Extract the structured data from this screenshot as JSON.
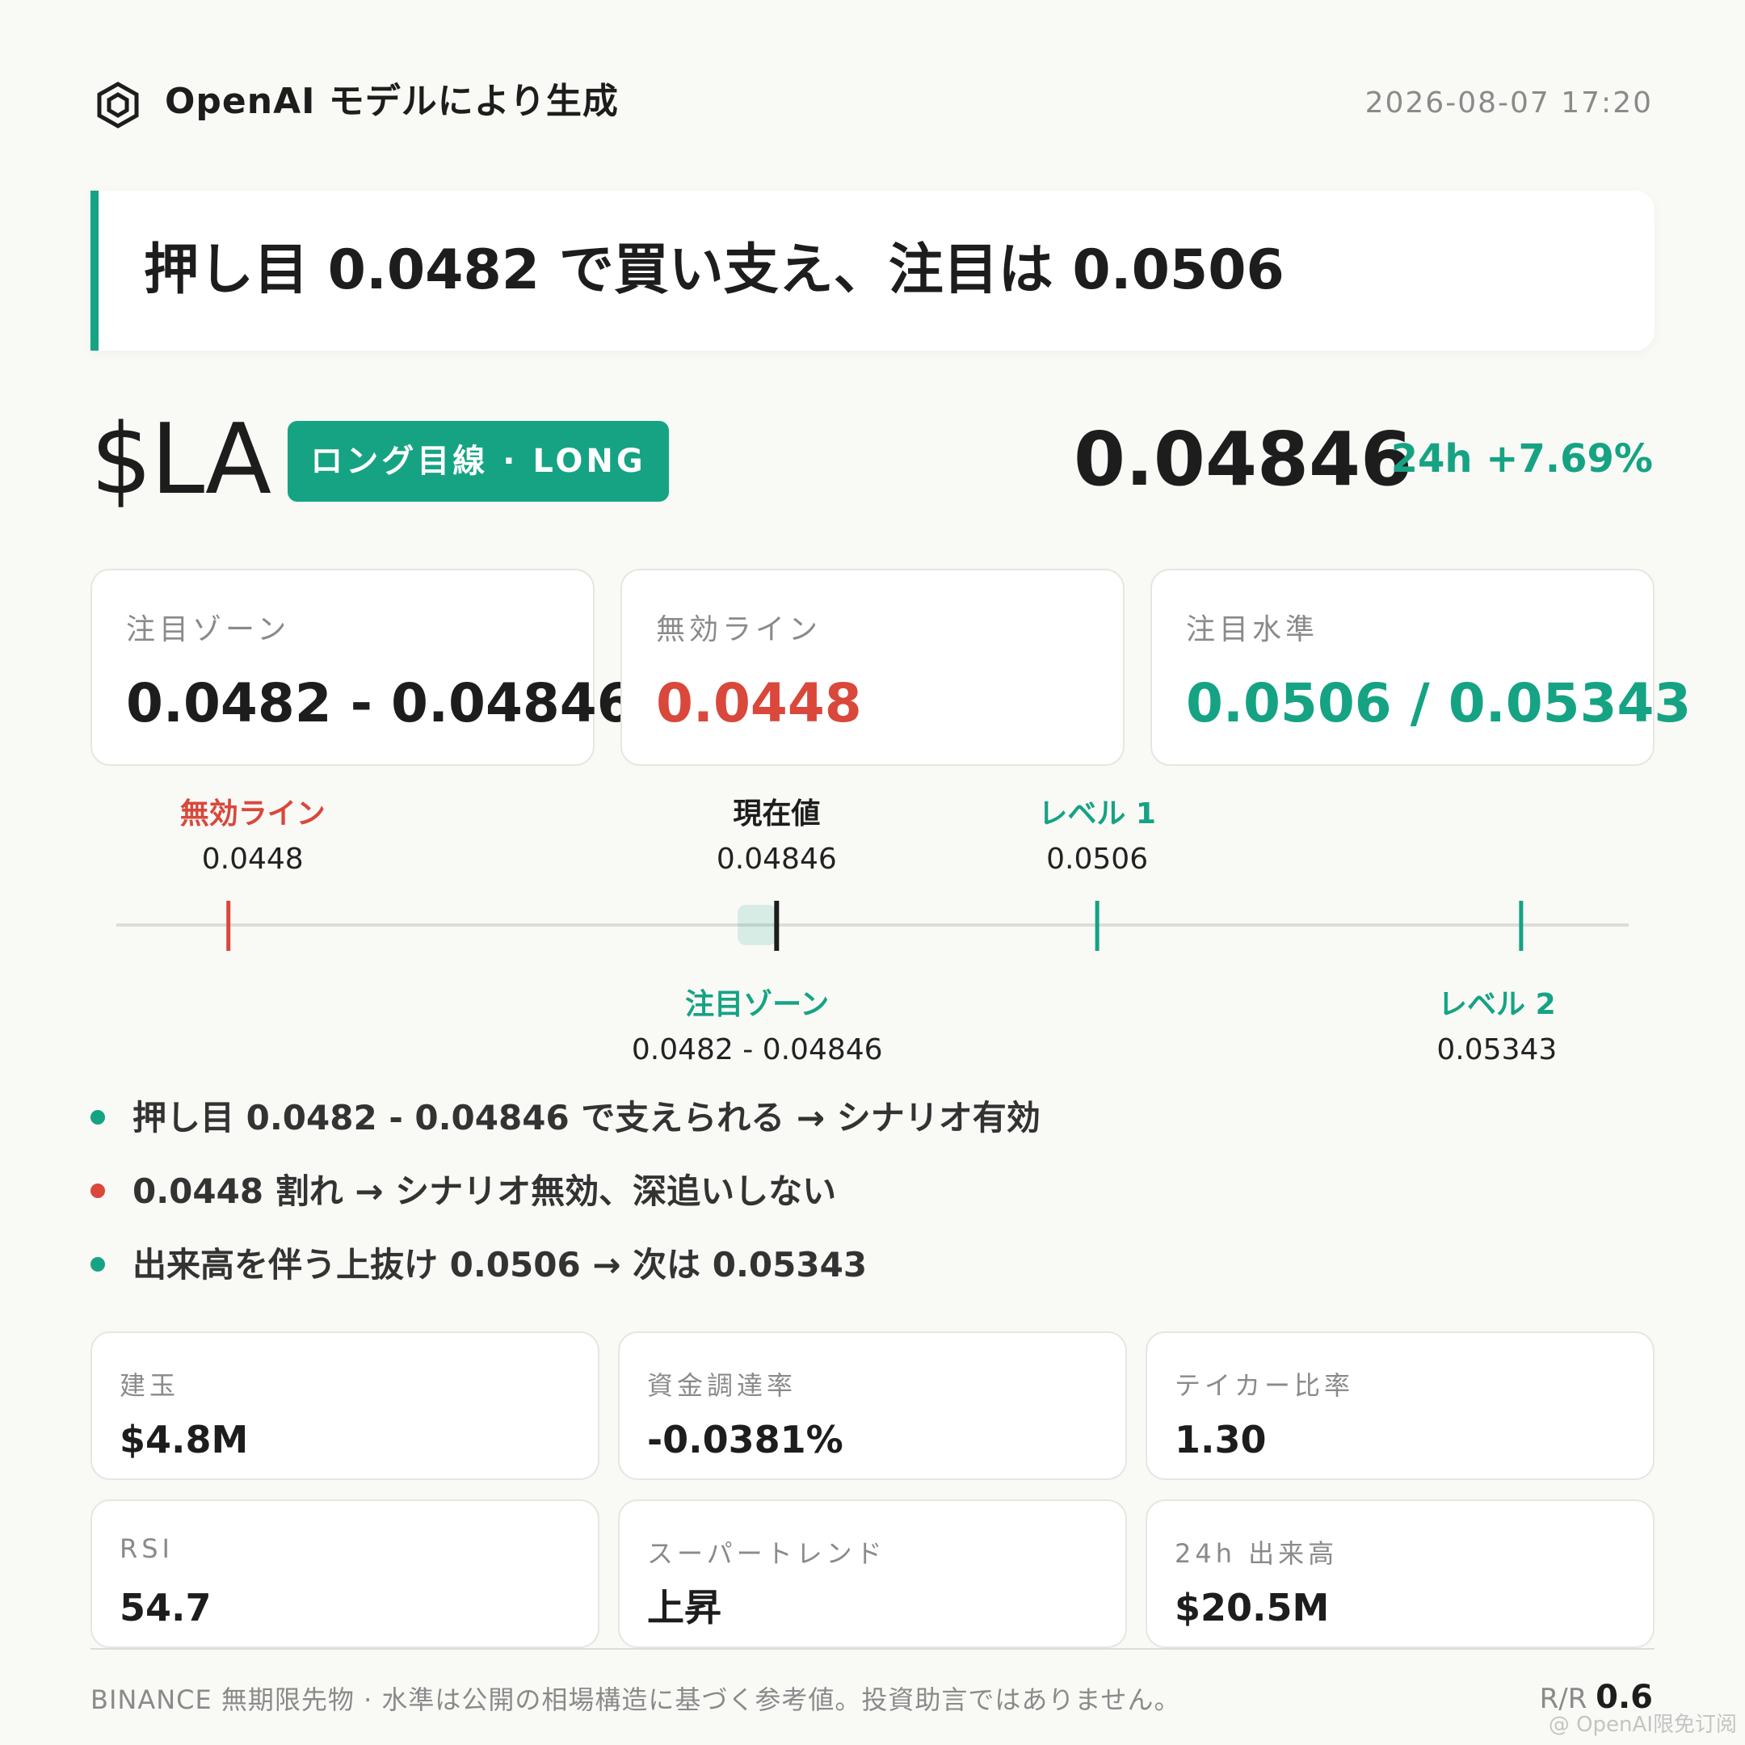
{
  "header": {
    "brand": "OpenAI モデルにより生成",
    "timestamp": "2026-08-07 17:20"
  },
  "headline": "押し目 0.0482 で買い支え、注目は 0.0506",
  "ticker": {
    "symbol": "$LA",
    "badge": "ロング目線 · LONG",
    "price": "0.04846",
    "change": "24h +7.69%"
  },
  "cards": [
    {
      "label": "注目ゾーン",
      "value": "0.0482 - 0.04846",
      "color": "#1d1d1d"
    },
    {
      "label": "無効ライン",
      "value": "0.0448",
      "color": "#d9483b"
    },
    {
      "label": "注目水準",
      "value": "0.0506 / 0.05343",
      "color": "#15a383"
    }
  ],
  "ladder": {
    "range": [
      0.0443,
      0.0539
    ],
    "invalid": {
      "title": "無効ライン",
      "value": "0.0448",
      "price": 0.0448,
      "color": "#d9483b"
    },
    "current": {
      "title": "現在値",
      "value": "0.04846",
      "price": 0.04846,
      "color": "#1d1d1d"
    },
    "level1": {
      "title": "レベル 1",
      "value": "0.0506",
      "price": 0.0506,
      "color": "#15a383"
    },
    "zone": {
      "title": "注目ゾーン",
      "value": "0.0482 - 0.04846",
      "low": 0.0482,
      "high": 0.04846,
      "color": "#15a383"
    },
    "level2": {
      "title": "レベル 2",
      "value": "0.05343",
      "price": 0.05343,
      "color": "#15a383"
    }
  },
  "scenarios": [
    {
      "text": "押し目 0.0482 - 0.04846 で支えられる → シナリオ有効",
      "color": "#15a383"
    },
    {
      "text": "0.0448 割れ → シナリオ無効、深追いしない",
      "color": "#d9483b"
    },
    {
      "text": "出来高を伴う上抜け 0.0506 → 次は 0.05343",
      "color": "#15a383"
    }
  ],
  "metrics": [
    {
      "label": "建玉",
      "value": "$4.8M"
    },
    {
      "label": "資金調達率",
      "value": "-0.0381%"
    },
    {
      "label": "テイカー比率",
      "value": "1.30"
    },
    {
      "label": "RSI",
      "value": "54.7"
    },
    {
      "label": "スーパートレンド",
      "value": "上昇"
    },
    {
      "label": "24h 出来高",
      "value": "$20.5M"
    }
  ],
  "footer": {
    "disclaimer": "BINANCE 無期限先物 · 水準は公開の相場構造に基づく参考値。投資助言ではありません。",
    "rr_label": "R/R",
    "rr_value": "0.6",
    "watermark": "@ OpenAI限免订阅"
  },
  "colors": {
    "accent": "#15a383",
    "danger": "#d9483b",
    "text": "#1d1d1d"
  }
}
